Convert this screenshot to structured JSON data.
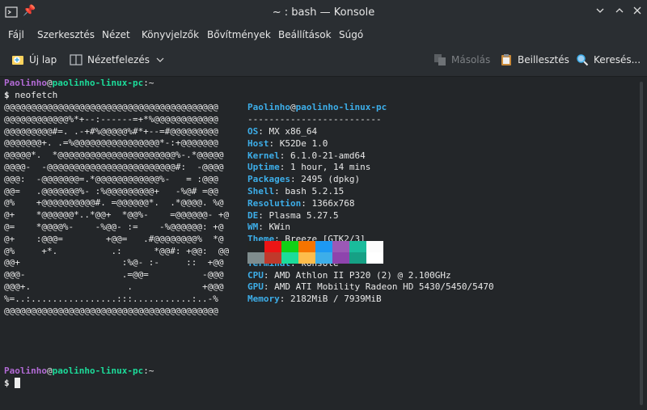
{
  "window": {
    "title": "~ : bash — Konsole"
  },
  "menu": {
    "items": [
      "Fájl",
      "Szerkesztés",
      "Nézet",
      "Könyvjelzők",
      "Bővítmények",
      "Beállítások",
      "Súgó"
    ]
  },
  "toolbar": {
    "new_tab": "Új lap",
    "split_view": "Nézetfelezés",
    "copy": "Másolás",
    "paste": "Beillesztés",
    "find": "Keresés..."
  },
  "terminal": {
    "prompt_user": "Paolinho",
    "prompt_at": "@",
    "prompt_host": "paolinho-linux-pc",
    "prompt_sep": ":",
    "prompt_path": "~",
    "prompt_symbol": "$",
    "command": " neofetch",
    "art": [
      "@@@@@@@@@@@@@@@@@@@@@@@@@@@@@@@@@@@@@@@@",
      "@@@@@@@@@@@@%*+--:------=+*%@@@@@@@@@@@@",
      "@@@@@@@@@#=. .-+#%@@@@@%#*+--=#@@@@@@@@@",
      "@@@@@@@+. .=%@@@@@@@@@@@@@@@@*-:+@@@@@@@",
      "@@@@@*.  *@@@@@@@@@@@@@@@@@@@@@@%-.*@@@@@",
      "@@@@-  -@@@@@@@@@@@@@@@@@@@@@@@@#:  -@@@@",
      "@@@:  -@@@@@@@=.*@@@@@@@@@@@@%-   = :@@@",
      "@@=   .@@@@@@@%- :%@@@@@@@@@+   -%@# =@@",
      "@%    +@@@@@@@@@@#. =@@@@@@*.  .*@@@@. %@",
      "@+    *@@@@@@*..*@@+  *@@%-    =@@@@@@- +@",
      "@=    *@@@@%-    -%@@- :=    -%@@@@@@: +@",
      "@+    :@@@=        +@@=   .#@@@@@@@@%  *@",
      "@%     +*.          .:      *@@#: +@@:  @@",
      "@@+                   :%@- :-     ::  +@@",
      "@@@-                  .=@@=          -@@@",
      "@@@+.                  .             +@@@",
      "%=..:................:::...........:..-%",
      "@@@@@@@@@@@@@@@@@@@@@@@@@@@@@@@@@@@@@@@@"
    ],
    "info_header_user": "Paolinho",
    "info_header_host": "paolinho-linux-pc",
    "info_separator": "-------------------------",
    "info": [
      {
        "label": "OS",
        "value": "MX x86_64"
      },
      {
        "label": "Host",
        "value": "K52De 1.0"
      },
      {
        "label": "Kernel",
        "value": "6.1.0-21-amd64"
      },
      {
        "label": "Uptime",
        "value": "1 hour, 14 mins"
      },
      {
        "label": "Packages",
        "value": "2495 (dpkg)"
      },
      {
        "label": "Shell",
        "value": "bash 5.2.15"
      },
      {
        "label": "Resolution",
        "value": "1366x768"
      },
      {
        "label": "DE",
        "value": "Plasma 5.27.5"
      },
      {
        "label": "WM",
        "value": "KWin"
      },
      {
        "label": "Theme",
        "value": "Breeze [GTK2/3]"
      },
      {
        "label": "Icons",
        "value": "gnome [GTK2/3]"
      },
      {
        "label": "Terminal",
        "value": "konsole"
      },
      {
        "label": "CPU",
        "value": "AMD Athlon II P320 (2) @ 2.100GHz"
      },
      {
        "label": "GPU",
        "value": "AMD ATI Mobility Radeon HD 5430/5450/5470"
      },
      {
        "label": "Memory",
        "value": "2182MiB / 7939MiB"
      }
    ],
    "palette_row1": [
      "#232627",
      "#ed1515",
      "#11d116",
      "#f67400",
      "#1d99f3",
      "#9b59b6",
      "#1abc9c",
      "#fcfcfc"
    ],
    "palette_row2": [
      "#7f8c8d",
      "#c0392b",
      "#1cdc9a",
      "#fdbc4b",
      "#3daee9",
      "#8e44ad",
      "#16a085",
      "#ffffff"
    ]
  },
  "colors": {
    "user": "#b36bd6",
    "host": "#1cdc9a",
    "info_label": "#3daee9",
    "background": "#232629"
  }
}
